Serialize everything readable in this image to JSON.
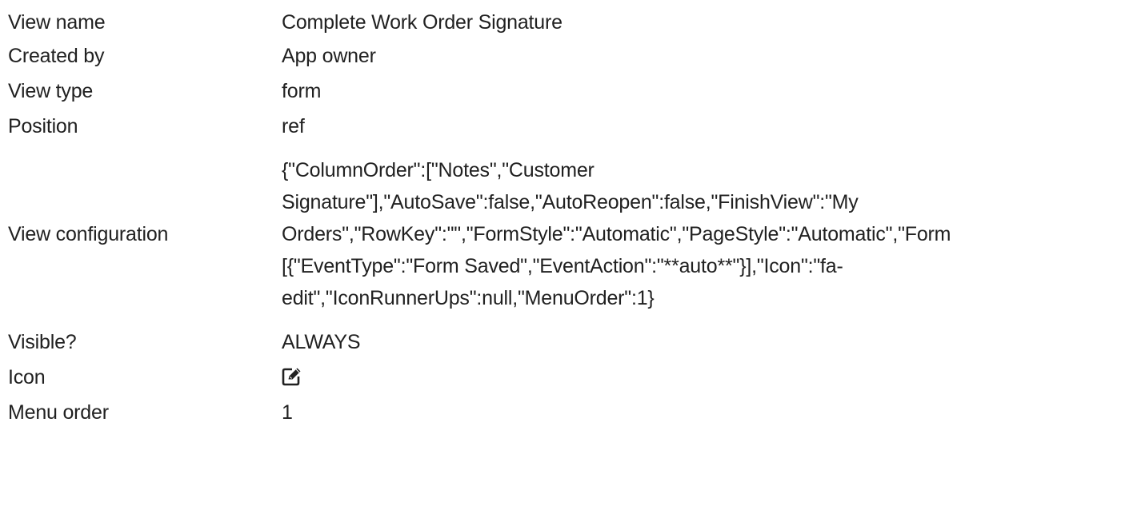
{
  "rows": {
    "view_name": {
      "label": "View name",
      "value": "Complete Work Order Signature"
    },
    "created_by": {
      "label": "Created by",
      "value": "App owner"
    },
    "view_type": {
      "label": "View type",
      "value": "form"
    },
    "position": {
      "label": "Position",
      "value": "ref"
    },
    "view_configuration": {
      "label": "View configuration",
      "lines": [
        "{\"ColumnOrder\":[\"Notes\",\"Customer",
        "Signature\"],\"AutoSave\":false,\"AutoReopen\":false,\"FinishView\":\"My",
        "Orders\",\"RowKey\":\"\",\"FormStyle\":\"Automatic\",\"PageStyle\":\"Automatic\",\"Form",
        "[{\"EventType\":\"Form Saved\",\"EventAction\":\"**auto**\"}],\"Icon\":\"fa-",
        "edit\",\"IconRunnerUps\":null,\"MenuOrder\":1}"
      ]
    },
    "visible": {
      "label": "Visible?",
      "value": "ALWAYS"
    },
    "icon": {
      "label": "Icon",
      "icon_name": "edit-icon"
    },
    "menu_order": {
      "label": "Menu order",
      "value": "1"
    }
  },
  "colors": {
    "text": "#212121",
    "background": "#ffffff"
  }
}
